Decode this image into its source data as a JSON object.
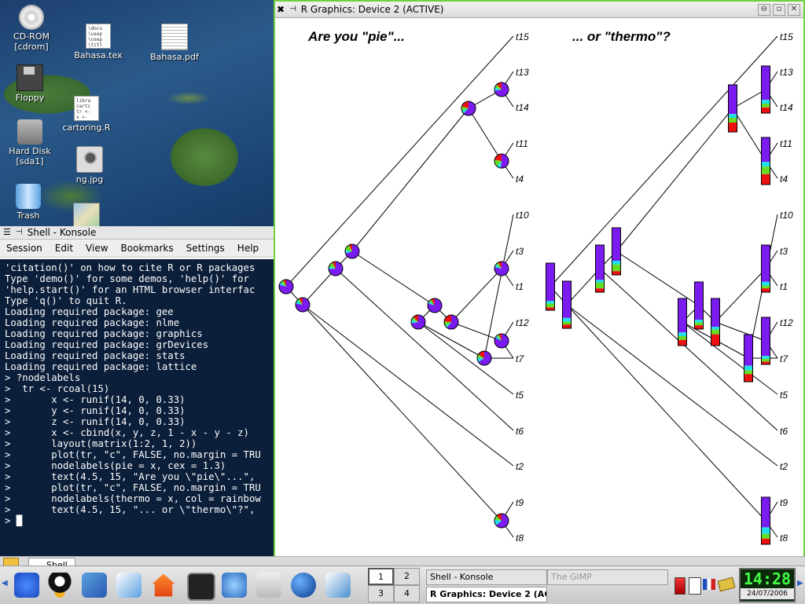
{
  "desktop": {
    "icons": [
      {
        "label": "CD-ROM\n[cdrom]"
      },
      {
        "label": "Bahasa.tex"
      },
      {
        "label": "Bahasa.pdf"
      },
      {
        "label": "Floppy"
      },
      {
        "label": "cartoring.R"
      },
      {
        "label": "Hard Disk\n[sda1]"
      },
      {
        "label": "ng.jpg"
      },
      {
        "label": "Trash"
      }
    ],
    "tex_preview": "\\docu\n\\usep\n\\usep\n\\titl",
    "r_preview": "libra\ncartc\ntr <-\nx <-"
  },
  "konsole": {
    "title": "Shell - Konsole",
    "menu": [
      "Session",
      "Edit",
      "View",
      "Bookmarks",
      "Settings",
      "Help"
    ],
    "lines": [
      "'citation()' on how to cite R or R packages",
      "",
      "Type 'demo()' for some demos, 'help()' for",
      "'help.start()' for an HTML browser interfac",
      "Type 'q()' to quit R.",
      "",
      "Loading required package: gee",
      "Loading required package: nlme",
      "Loading required package: graphics",
      "Loading required package: grDevices",
      "Loading required package: stats",
      "Loading required package: lattice",
      "> ?nodelabels",
      ">  tr <- rcoal(15)",
      ">       x <- runif(14, 0, 0.33)",
      ">       y <- runif(14, 0, 0.33)",
      ">       z <- runif(14, 0, 0.33)",
      ">       x <- cbind(x, y, z, 1 - x - y - z)",
      ">       layout(matrix(1:2, 1, 2))",
      ">       plot(tr, \"c\", FALSE, no.margin = TRU",
      ">       nodelabels(pie = x, cex = 1.3)",
      ">       text(4.5, 15, \"Are you \\\"pie\\\"...\",",
      ">       plot(tr, \"c\", FALSE, no.margin = TRU",
      ">       nodelabels(thermo = x, col = rainbow",
      ">       text(4.5, 15, \"... or \\\"thermo\\\"?\",",
      "> █"
    ]
  },
  "rwindow": {
    "title": "R Graphics: Device 2 (ACTIVE)",
    "buttons": [
      "⊖",
      "▫",
      "✕"
    ],
    "plot_titles": [
      "Are you \"pie\"...",
      "... or \"thermo\"?"
    ],
    "tip_labels": [
      "t15",
      "t13",
      "t14",
      "t11",
      "t4",
      "t10",
      "t3",
      "t1",
      "t12",
      "t7",
      "t5",
      "t6",
      "t2",
      "t9",
      "t8"
    ]
  },
  "node_values": [
    [
      0.8,
      0.06,
      0.08,
      0.06
    ],
    [
      0.78,
      0.08,
      0.06,
      0.08
    ],
    [
      0.74,
      0.06,
      0.12,
      0.08
    ],
    [
      0.7,
      0.08,
      0.14,
      0.08
    ],
    [
      0.72,
      0.08,
      0.08,
      0.12
    ],
    [
      0.8,
      0.06,
      0.06,
      0.08
    ],
    [
      0.6,
      0.06,
      0.1,
      0.24
    ],
    [
      0.62,
      0.08,
      0.1,
      0.2
    ],
    [
      0.72,
      0.08,
      0.08,
      0.12
    ],
    [
      0.52,
      0.1,
      0.16,
      0.22
    ],
    [
      0.66,
      0.1,
      0.08,
      0.16
    ],
    [
      0.78,
      0.08,
      0.06,
      0.08
    ],
    [
      0.82,
      0.06,
      0.06,
      0.06
    ],
    [
      0.64,
      0.14,
      0.1,
      0.12
    ]
  ],
  "colors": {
    "pie": [
      "#7a1cf0",
      "#22e0e8",
      "#66dd22",
      "#ee1111"
    ],
    "accent": "#6fcf3f"
  },
  "taskbar": {
    "konsole_tab": "Shell",
    "pager": [
      "1",
      "2",
      "3",
      "4"
    ],
    "tasks": [
      "Shell - Konsole",
      "R Graphics: Device 2 (AC",
      "The GIMP"
    ],
    "clock": "14:28",
    "date": "24/07/2006"
  }
}
